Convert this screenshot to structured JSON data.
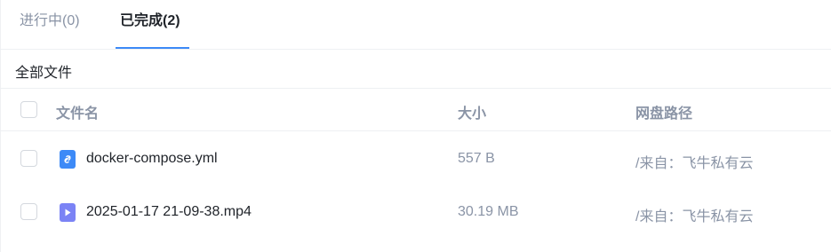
{
  "tabs": [
    {
      "label": "进行中(0)",
      "active": false
    },
    {
      "label": "已完成(2)",
      "active": true
    }
  ],
  "breadcrumb": {
    "label": "全部文件"
  },
  "table": {
    "headers": {
      "name": "文件名",
      "size": "大小",
      "path": "网盘路径"
    },
    "rows": [
      {
        "name": "docker-compose.yml",
        "size": "557 B",
        "path": "/来自：飞牛私有云",
        "icon": "link-file-icon"
      },
      {
        "name": "2025-01-17 21-09-38.mp4",
        "size": "30.19 MB",
        "path": "/来自：飞牛私有云",
        "icon": "video-file-icon"
      }
    ]
  },
  "colors": {
    "accent": "#3d8af7",
    "link_icon": "#3d8af7",
    "video_icon": "#7b83f5",
    "muted": "#8a94a6"
  }
}
